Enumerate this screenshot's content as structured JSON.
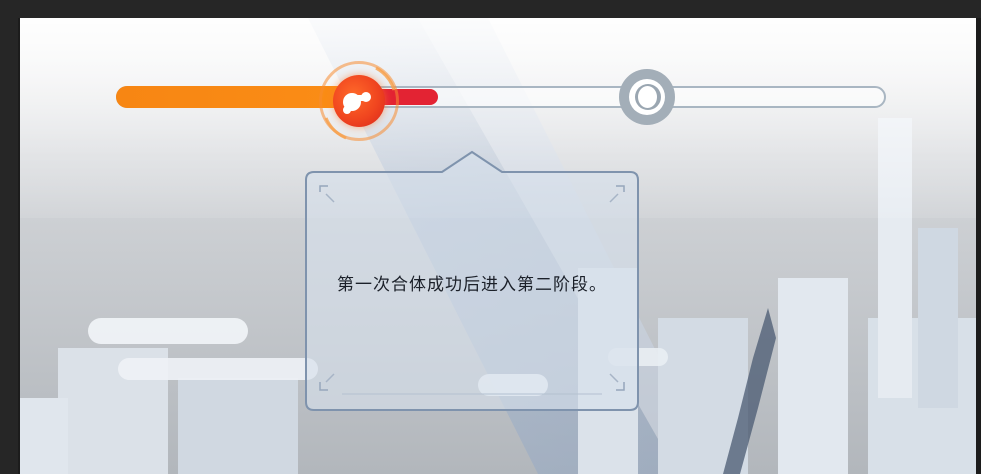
{
  "progress": {
    "stage_count": 2,
    "current_stage": 1,
    "completion": 0.43,
    "stage_1_icon": "fusion-icon",
    "stage_2_icon": "ring-icon",
    "colors": {
      "fill": "#fb8d16",
      "segment": "#e32333",
      "track": "#a9b6c2",
      "node_active": "#f0451f",
      "node_inactive": "#a3aeb8"
    }
  },
  "tooltip": {
    "text": "第一次合体成功后进入第二阶段。"
  }
}
